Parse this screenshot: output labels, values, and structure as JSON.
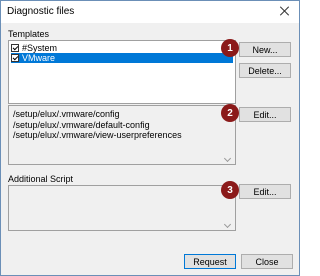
{
  "window": {
    "title": "Diagnostic files"
  },
  "templates": {
    "label": "Templates",
    "items": [
      {
        "label": "#System",
        "checked": true,
        "selected": false
      },
      {
        "label": "VMware",
        "checked": true,
        "selected": true
      }
    ],
    "new_label": "New...",
    "delete_label": "Delete..."
  },
  "paths": {
    "lines": [
      "/setup/elux/.vmware/config",
      "/setup/elux/.vmware/default-config",
      "/setup/elux/.vmware/view-userpreferences"
    ],
    "edit_label": "Edit..."
  },
  "script": {
    "label": "Additional Script",
    "edit_label": "Edit..."
  },
  "badges": [
    "1",
    "2",
    "3"
  ],
  "footer": {
    "request_label": "Request",
    "close_label": "Close"
  },
  "colors": {
    "badge": "#8b1a1a",
    "selection": "#0078d7"
  }
}
